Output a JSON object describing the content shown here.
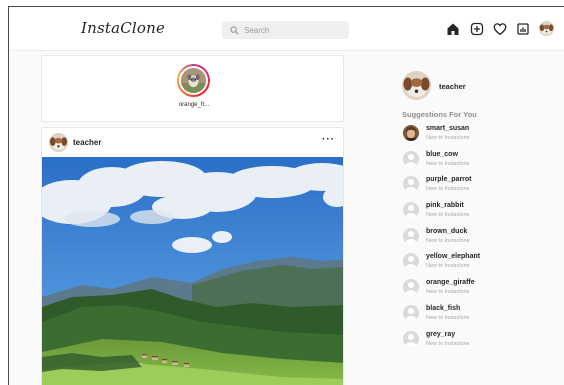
{
  "header": {
    "logo": "InstaClone",
    "search_placeholder": "Search",
    "icons": [
      "home-icon",
      "new-post-icon",
      "heart-icon",
      "activity-icon",
      "profile-avatar"
    ]
  },
  "stories": [
    {
      "username": "orange_fr..."
    }
  ],
  "post": {
    "username": "teacher",
    "more": "···"
  },
  "sidebar": {
    "username": "teacher",
    "suggestions_title": "Suggestions For You",
    "suggestions": [
      {
        "username": "smart_susan",
        "subtitle": "New to Instaclone"
      },
      {
        "username": "blue_cow",
        "subtitle": "New to Instaclone"
      },
      {
        "username": "purple_parrot",
        "subtitle": "New to Instaclone"
      },
      {
        "username": "pink_rabbit",
        "subtitle": "New to Instaclone"
      },
      {
        "username": "brown_duck",
        "subtitle": "New to Instaclone"
      },
      {
        "username": "yellow_elephant",
        "subtitle": "New to Instaclone"
      },
      {
        "username": "orange_giraffe",
        "subtitle": "New to Instaclone"
      },
      {
        "username": "black_fish",
        "subtitle": "New to Instaclone"
      },
      {
        "username": "grey_ray",
        "subtitle": "New to Instaclone"
      }
    ]
  },
  "colors": {
    "background": "#fafafa",
    "card": "#ffffff",
    "border": "#e6e6e6",
    "muted_text": "#a8a8a8"
  }
}
